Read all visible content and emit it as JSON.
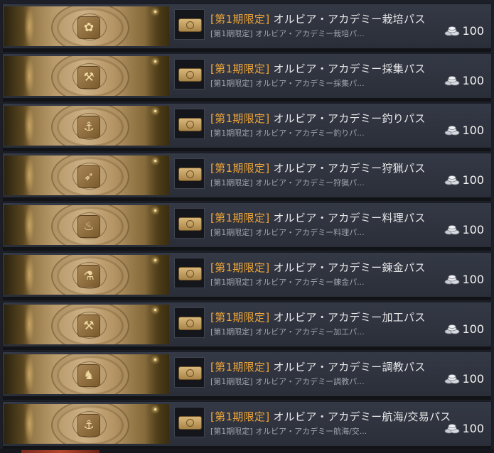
{
  "items": [
    {
      "tag": "[第1期限定]",
      "name": "オルビア・アカデミー栽培パス",
      "sub": "[第1期限定] オルビア・アカデミー栽培パ...",
      "emblem": "✿",
      "price": "100"
    },
    {
      "tag": "[第1期限定]",
      "name": "オルビア・アカデミー採集パス",
      "sub": "[第1期限定] オルビア・アカデミー採集パ...",
      "emblem": "⚒",
      "price": "100"
    },
    {
      "tag": "[第1期限定]",
      "name": "オルビア・アカデミー釣りパス",
      "sub": "[第1期限定] オルビア・アカデミー釣りパ...",
      "emblem": "⚓",
      "price": "100"
    },
    {
      "tag": "[第1期限定]",
      "name": "オルビア・アカデミー狩猟パス",
      "sub": "[第1期限定] オルビア・アカデミー狩猟パ...",
      "emblem": "➶",
      "price": "100"
    },
    {
      "tag": "[第1期限定]",
      "name": "オルビア・アカデミー料理パス",
      "sub": "[第1期限定] オルビア・アカデミー料理パ...",
      "emblem": "♨",
      "price": "100"
    },
    {
      "tag": "[第1期限定]",
      "name": "オルビア・アカデミー錬金パス",
      "sub": "[第1期限定] オルビア・アカデミー錬金パ...",
      "emblem": "⚗",
      "price": "100"
    },
    {
      "tag": "[第1期限定]",
      "name": "オルビア・アカデミー加工パス",
      "sub": "[第1期限定] オルビア・アカデミー加工パ...",
      "emblem": "⚒",
      "price": "100"
    },
    {
      "tag": "[第1期限定]",
      "name": "オルビア・アカデミー調教パス",
      "sub": "[第1期限定] オルビア・アカデミー調教パ...",
      "emblem": "♞",
      "price": "100"
    },
    {
      "tag": "[第1期限定]",
      "name": "オルビア・アカデミー航海/交易パス",
      "sub": "[第1期限定] オルビア・アカデミー航海/交...",
      "emblem": "⚓",
      "price": "100"
    }
  ],
  "icons": {
    "price": "silver-coins-icon",
    "thumbnail": "ticket-icon"
  },
  "colors": {
    "tag": "#f0a637",
    "title": "#e8e8e8",
    "subtitle": "#9ea2ab",
    "row_background": "#343946"
  }
}
